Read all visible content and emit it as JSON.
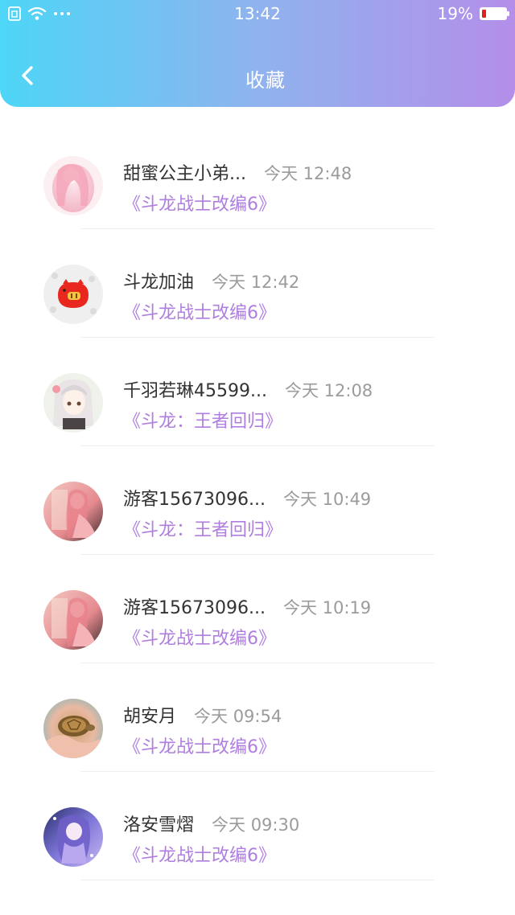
{
  "status_bar": {
    "time": "13:42",
    "battery_percent_label": "19%",
    "battery_level": 0.19,
    "icons": [
      "sim-icon",
      "wifi-icon",
      "more-dots-icon",
      "battery-icon"
    ]
  },
  "nav": {
    "title": "收藏",
    "back_icon": "chevron-left-icon"
  },
  "colors": {
    "header_gradient": [
      "#4dd6f7",
      "#b48ee9"
    ],
    "book_title": "#b07ee0",
    "name": "#333333",
    "time": "#9b9b9b"
  },
  "items": [
    {
      "name": "甜蜜公主小弟...",
      "time": "今天 12:48",
      "book": "《斗龙战士改编6》",
      "avatar": "anime-girl-pink-avatar"
    },
    {
      "name": "斗龙加油",
      "time": "今天 12:42",
      "book": "《斗龙战士改编6》",
      "avatar": "red-pig-avatar"
    },
    {
      "name": "千羽若琳45599...",
      "time": "今天 12:08",
      "book": "《斗龙：王者回归》",
      "avatar": "anime-girl-white-hair-avatar"
    },
    {
      "name": "游客15673096...",
      "time": "今天 10:49",
      "book": "《斗龙：王者回归》",
      "avatar": "anime-girl-pink-dress-avatar"
    },
    {
      "name": "游客15673096...",
      "time": "今天 10:19",
      "book": "《斗龙战士改编6》",
      "avatar": "anime-girl-pink-dress-avatar"
    },
    {
      "name": "胡安月",
      "time": "今天 09:54",
      "book": "《斗龙战士改编6》",
      "avatar": "turtle-photo-avatar"
    },
    {
      "name": "洛安雪熠",
      "time": "今天 09:30",
      "book": "《斗龙战士改编6》",
      "avatar": "anime-girl-purple-avatar"
    }
  ]
}
